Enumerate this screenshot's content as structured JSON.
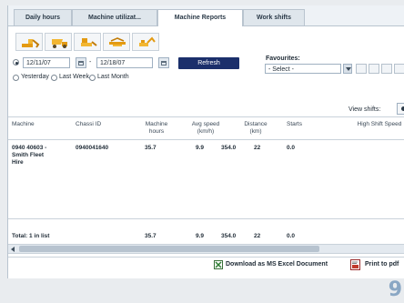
{
  "tabs": [
    {
      "label": "Daily hours"
    },
    {
      "label": "Machine utilizat..."
    },
    {
      "label": "Machine Reports"
    },
    {
      "label": "Work shifts"
    }
  ],
  "toolbar_icons": [
    "excavator-icon",
    "dump-truck-icon",
    "loader-icon",
    "crane-icon",
    "digger-icon"
  ],
  "filter": {
    "date_from": "12/11/07",
    "date_separator": "-",
    "date_to": "12/18/07",
    "refresh_label": "Refresh",
    "quick_ranges": [
      "Yesterday",
      "Last Week",
      "Last Month"
    ]
  },
  "favourites": {
    "label": "Favourites:",
    "selected": "- Select -"
  },
  "view_shifts_label": "View shifts:",
  "table": {
    "columns": [
      "Machine",
      "Chassi ID",
      "Machine hours",
      "Avg speed (km/h)",
      "Distance (km)",
      "Starts",
      "High Shift Speed"
    ],
    "rows": [
      {
        "machine": "0940 40603 - Smith Fleet Hire",
        "chassi_id": "0940041640",
        "hours": "35.7",
        "avg_speed": "9.9",
        "distance": "354.0",
        "starts": "22",
        "high_speed": "0.0"
      }
    ],
    "total": {
      "label": "Total: 1 in list",
      "hours": "35.7",
      "avg_speed": "9.9",
      "distance": "354.0",
      "starts": "22",
      "high_speed": "0.0"
    }
  },
  "footer": {
    "excel_label": "Download as MS Excel Document",
    "pdf_label": "Print to pdf"
  },
  "page_number": "9"
}
